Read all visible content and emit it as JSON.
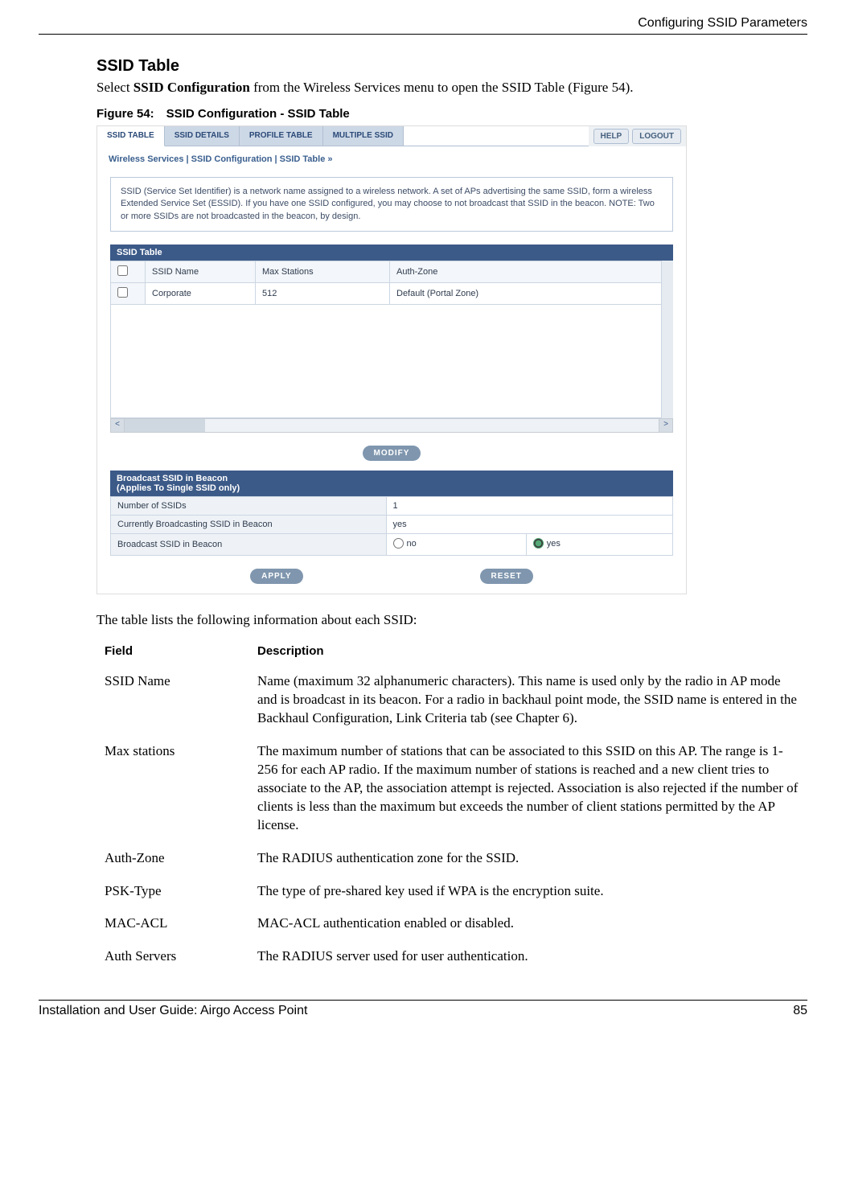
{
  "header": {
    "right": "Configuring SSID Parameters"
  },
  "section": {
    "title": "SSID Table",
    "intro_a": "Select ",
    "intro_b": "SSID Configuration",
    "intro_c": " from the Wireless Services menu to open the SSID Table (Figure 54).",
    "figcap": "Figure 54: SSID Configuration - SSID Table"
  },
  "shot": {
    "tabs": [
      "SSID TABLE",
      "SSID DETAILS",
      "PROFILE TABLE",
      "MULTIPLE SSID"
    ],
    "help": "HELP",
    "logout": "LOGOUT",
    "breadcrumb": "Wireless Services | SSID Configuration | SSID Table  »",
    "infobox": "SSID (Service Set Identifier) is a network name assigned to a wireless network. A set of APs advertising the same SSID, form a wireless Extended Service Set (ESSID). If you have one SSID configured, you may choose to not broadcast that SSID in the beacon. NOTE: Two or more SSIDs are not broadcasted in the beacon, by design.",
    "table_title": "SSID Table",
    "cols": {
      "c1": "SSID Name",
      "c2": "Max Stations",
      "c3": "Auth-Zone"
    },
    "row": {
      "name": "Corporate",
      "max": "512",
      "zone": "Default (Portal Zone)"
    },
    "modify": "MODIFY",
    "broadcast_title": "Broadcast SSID in Beacon\n(Applies To Single SSID only)",
    "b1_label": "Number of SSIDs",
    "b1_value": "1",
    "b2_label": "Currently Broadcasting SSID in Beacon",
    "b2_value": "yes",
    "b3_label": "Broadcast SSID in Beacon",
    "rno": "no",
    "ryes": "yes",
    "apply": "APPLY",
    "reset": "RESET"
  },
  "after_para": "The table lists the following information about each SSID:",
  "defs": {
    "head_field": "Field",
    "head_desc": "Description",
    "rows": [
      {
        "f": "SSID Name",
        "d": "Name (maximum 32 alphanumeric characters). This name is used only by the radio in AP mode and is broadcast in its beacon. For a radio in backhaul point mode, the SSID name is entered in the Backhaul Configuration, Link Criteria tab (see Chapter 6)."
      },
      {
        "f": "Max stations",
        "d": "The maximum number of stations that can be associated to this SSID on this AP. The range is 1-256 for each AP radio. If the maximum number of stations is reached and a new client tries to associate to the AP, the association attempt is rejected. Association is also rejected if the number of clients is less than the maximum but exceeds the number of client stations permitted by the AP license."
      },
      {
        "f": "Auth-Zone",
        "d": "The RADIUS authentication zone for the SSID."
      },
      {
        "f": "PSK-Type",
        "d": "The type of pre-shared key used if WPA is the encryption suite."
      },
      {
        "f": "MAC-ACL",
        "d": "MAC-ACL authentication enabled or disabled."
      },
      {
        "f": "Auth Servers",
        "d": "The RADIUS server used for user authentication."
      }
    ]
  },
  "footer": {
    "left": "Installation and User Guide: Airgo Access Point",
    "right": "85"
  }
}
